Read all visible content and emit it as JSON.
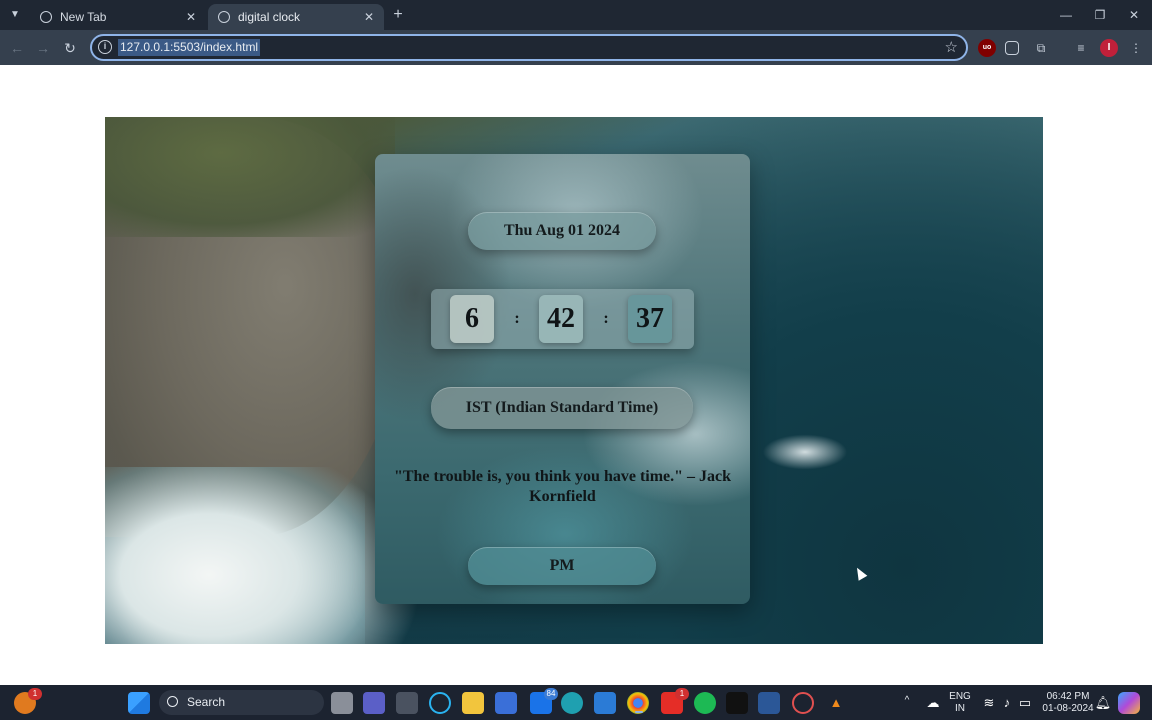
{
  "browser": {
    "tabs": [
      {
        "title": "New Tab",
        "close": "✕"
      },
      {
        "title": "digital clock",
        "close": "✕"
      }
    ],
    "new_tab": "+",
    "window_controls": {
      "minimize": "—",
      "maximize": "❐",
      "close": "✕"
    },
    "nav": {
      "back": "←",
      "forward": "→",
      "reload": "↻"
    },
    "address_bar": {
      "url": "127.0.0.1:5503/index.html",
      "site_info_icon": "i",
      "bookmark_icon": "☆"
    },
    "extensions": {
      "ublock": "uo",
      "avatar": "I"
    }
  },
  "clock": {
    "date": "Thu Aug 01 2024",
    "hours": "6",
    "minutes": "42",
    "seconds": "37",
    "separator": ":",
    "timezone": "IST (Indian Standard Time)",
    "quote": "\"The trouble is, you think you have time.\" – Jack Kornfield",
    "meridiem": "PM"
  },
  "taskbar": {
    "search_label": "Search",
    "badges": {
      "widgets": "1",
      "mail": "84",
      "youtube": "1"
    },
    "tray": {
      "lang_line1": "ENG",
      "lang_line2": "IN",
      "time": "06:42 PM",
      "date": "01-08-2024",
      "chevron": "^"
    }
  }
}
